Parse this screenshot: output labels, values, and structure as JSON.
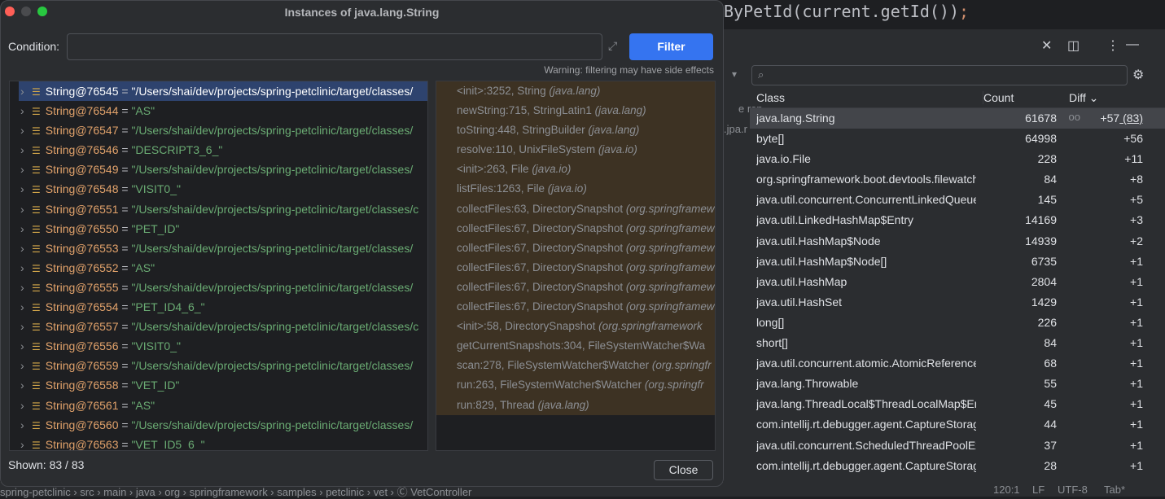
{
  "editor": {
    "code": "ByPetId(current.getId())",
    "semicolon": ";"
  },
  "memory": {
    "toolbar": {
      "close": "✕",
      "layout": "◫",
      "more": "⋮",
      "minimize": "—",
      "dropdown": "▾",
      "settings": "⚙"
    },
    "search": {
      "placeholder": "",
      "icon": "search-icon"
    },
    "side_fragments": [
      "e rep",
      ".jpa.r"
    ],
    "columns": {
      "class": "Class",
      "count": "Count",
      "diff": "Diff ⌄"
    },
    "rows": [
      {
        "cls": "java.lang.String",
        "count": "61678",
        "diff": "+57",
        "extra": " (83)",
        "tracked": true
      },
      {
        "cls": "byte[]",
        "count": "64998",
        "diff": "+56"
      },
      {
        "cls": "java.io.File",
        "count": "228",
        "diff": "+11"
      },
      {
        "cls": "org.springframework.boot.devtools.filewatch",
        "count": "84",
        "diff": "+8"
      },
      {
        "cls": "java.util.concurrent.ConcurrentLinkedQueue",
        "count": "145",
        "diff": "+5"
      },
      {
        "cls": "java.util.LinkedHashMap$Entry",
        "count": "14169",
        "diff": "+3"
      },
      {
        "cls": "java.util.HashMap$Node",
        "count": "14939",
        "diff": "+2"
      },
      {
        "cls": "java.util.HashMap$Node[]",
        "count": "6735",
        "diff": "+1"
      },
      {
        "cls": "java.util.HashMap",
        "count": "2804",
        "diff": "+1"
      },
      {
        "cls": "java.util.HashSet",
        "count": "1429",
        "diff": "+1"
      },
      {
        "cls": "long[]",
        "count": "226",
        "diff": "+1"
      },
      {
        "cls": "short[]",
        "count": "84",
        "diff": "+1"
      },
      {
        "cls": "java.util.concurrent.atomic.AtomicReference",
        "count": "68",
        "diff": "+1"
      },
      {
        "cls": "java.lang.Throwable",
        "count": "55",
        "diff": "+1"
      },
      {
        "cls": "java.lang.ThreadLocal$ThreadLocalMap$Entry",
        "count": "45",
        "diff": "+1"
      },
      {
        "cls": "com.intellij.rt.debugger.agent.CaptureStorage",
        "count": "44",
        "diff": "+1"
      },
      {
        "cls": "java.util.concurrent.ScheduledThreadPoolExecutor",
        "count": "37",
        "diff": "+1"
      },
      {
        "cls": "com.intellij.rt.debugger.agent.CaptureStorage",
        "count": "28",
        "diff": "+1"
      }
    ]
  },
  "status": {
    "breadcrumb": "spring-petclinic  ›  src  ›  main  ›  java  ›  org  ›  springframework  ›  samples  ›  petclinic  ›  vet  ›  Ⓒ VetController",
    "position": "120:1",
    "line_sep": "LF",
    "encoding": "UTF-8",
    "indent": "Tab*"
  },
  "dialog": {
    "title": "Instances of java.lang.String",
    "condition_label": "Condition:",
    "condition_value": "",
    "filter_label": "Filter",
    "warning": "Warning: filtering may have side effects",
    "shown": "Shown: 83 / 83",
    "close_label": "Close",
    "instances": [
      {
        "name": "String@76545",
        "value": "\"/Users/shai/dev/projects/spring-petclinic/target/classes/"
      },
      {
        "name": "String@76544",
        "value": "\"AS\""
      },
      {
        "name": "String@76547",
        "value": "\"/Users/shai/dev/projects/spring-petclinic/target/classes/"
      },
      {
        "name": "String@76546",
        "value": "\"DESCRIPT3_6_\""
      },
      {
        "name": "String@76549",
        "value": "\"/Users/shai/dev/projects/spring-petclinic/target/classes/"
      },
      {
        "name": "String@76548",
        "value": "\"VISIT0_\""
      },
      {
        "name": "String@76551",
        "value": "\"/Users/shai/dev/projects/spring-petclinic/target/classes/c"
      },
      {
        "name": "String@76550",
        "value": "\"PET_ID\""
      },
      {
        "name": "String@76553",
        "value": "\"/Users/shai/dev/projects/spring-petclinic/target/classes/"
      },
      {
        "name": "String@76552",
        "value": "\"AS\""
      },
      {
        "name": "String@76555",
        "value": "\"/Users/shai/dev/projects/spring-petclinic/target/classes/"
      },
      {
        "name": "String@76554",
        "value": "\"PET_ID4_6_\""
      },
      {
        "name": "String@76557",
        "value": "\"/Users/shai/dev/projects/spring-petclinic/target/classes/c"
      },
      {
        "name": "String@76556",
        "value": "\"VISIT0_\""
      },
      {
        "name": "String@76559",
        "value": "\"/Users/shai/dev/projects/spring-petclinic/target/classes/"
      },
      {
        "name": "String@76558",
        "value": "\"VET_ID\""
      },
      {
        "name": "String@76561",
        "value": "\"AS\""
      },
      {
        "name": "String@76560",
        "value": "\"/Users/shai/dev/projects/spring-petclinic/target/classes/"
      },
      {
        "name": "String@76563",
        "value": "\"VET_ID5_6_\""
      }
    ],
    "frames": [
      {
        "m": "<init>:3252, String ",
        "p": "(java.lang)"
      },
      {
        "m": "newString:715, StringLatin1 ",
        "p": "(java.lang)"
      },
      {
        "m": "toString:448, StringBuilder ",
        "p": "(java.lang)"
      },
      {
        "m": "resolve:110, UnixFileSystem ",
        "p": "(java.io)"
      },
      {
        "m": "<init>:263, File ",
        "p": "(java.io)"
      },
      {
        "m": "listFiles:1263, File ",
        "p": "(java.io)"
      },
      {
        "m": "collectFiles:63, DirectorySnapshot ",
        "p": "(org.springframework"
      },
      {
        "m": "collectFiles:67, DirectorySnapshot ",
        "p": "(org.springframework"
      },
      {
        "m": "collectFiles:67, DirectorySnapshot ",
        "p": "(org.springframework"
      },
      {
        "m": "collectFiles:67, DirectorySnapshot ",
        "p": "(org.springframework"
      },
      {
        "m": "collectFiles:67, DirectorySnapshot ",
        "p": "(org.springframework"
      },
      {
        "m": "collectFiles:67, DirectorySnapshot ",
        "p": "(org.springframework"
      },
      {
        "m": "<init>:58, DirectorySnapshot ",
        "p": "(org.springframework"
      },
      {
        "m": "getCurrentSnapshots:304, FileSystemWatcher$Wa",
        "p": ""
      },
      {
        "m": "scan:278, FileSystemWatcher$Watcher ",
        "p": "(org.springfr"
      },
      {
        "m": "run:263, FileSystemWatcher$Watcher ",
        "p": "(org.springfr"
      },
      {
        "m": "run:829, Thread ",
        "p": "(java.lang)"
      }
    ]
  }
}
